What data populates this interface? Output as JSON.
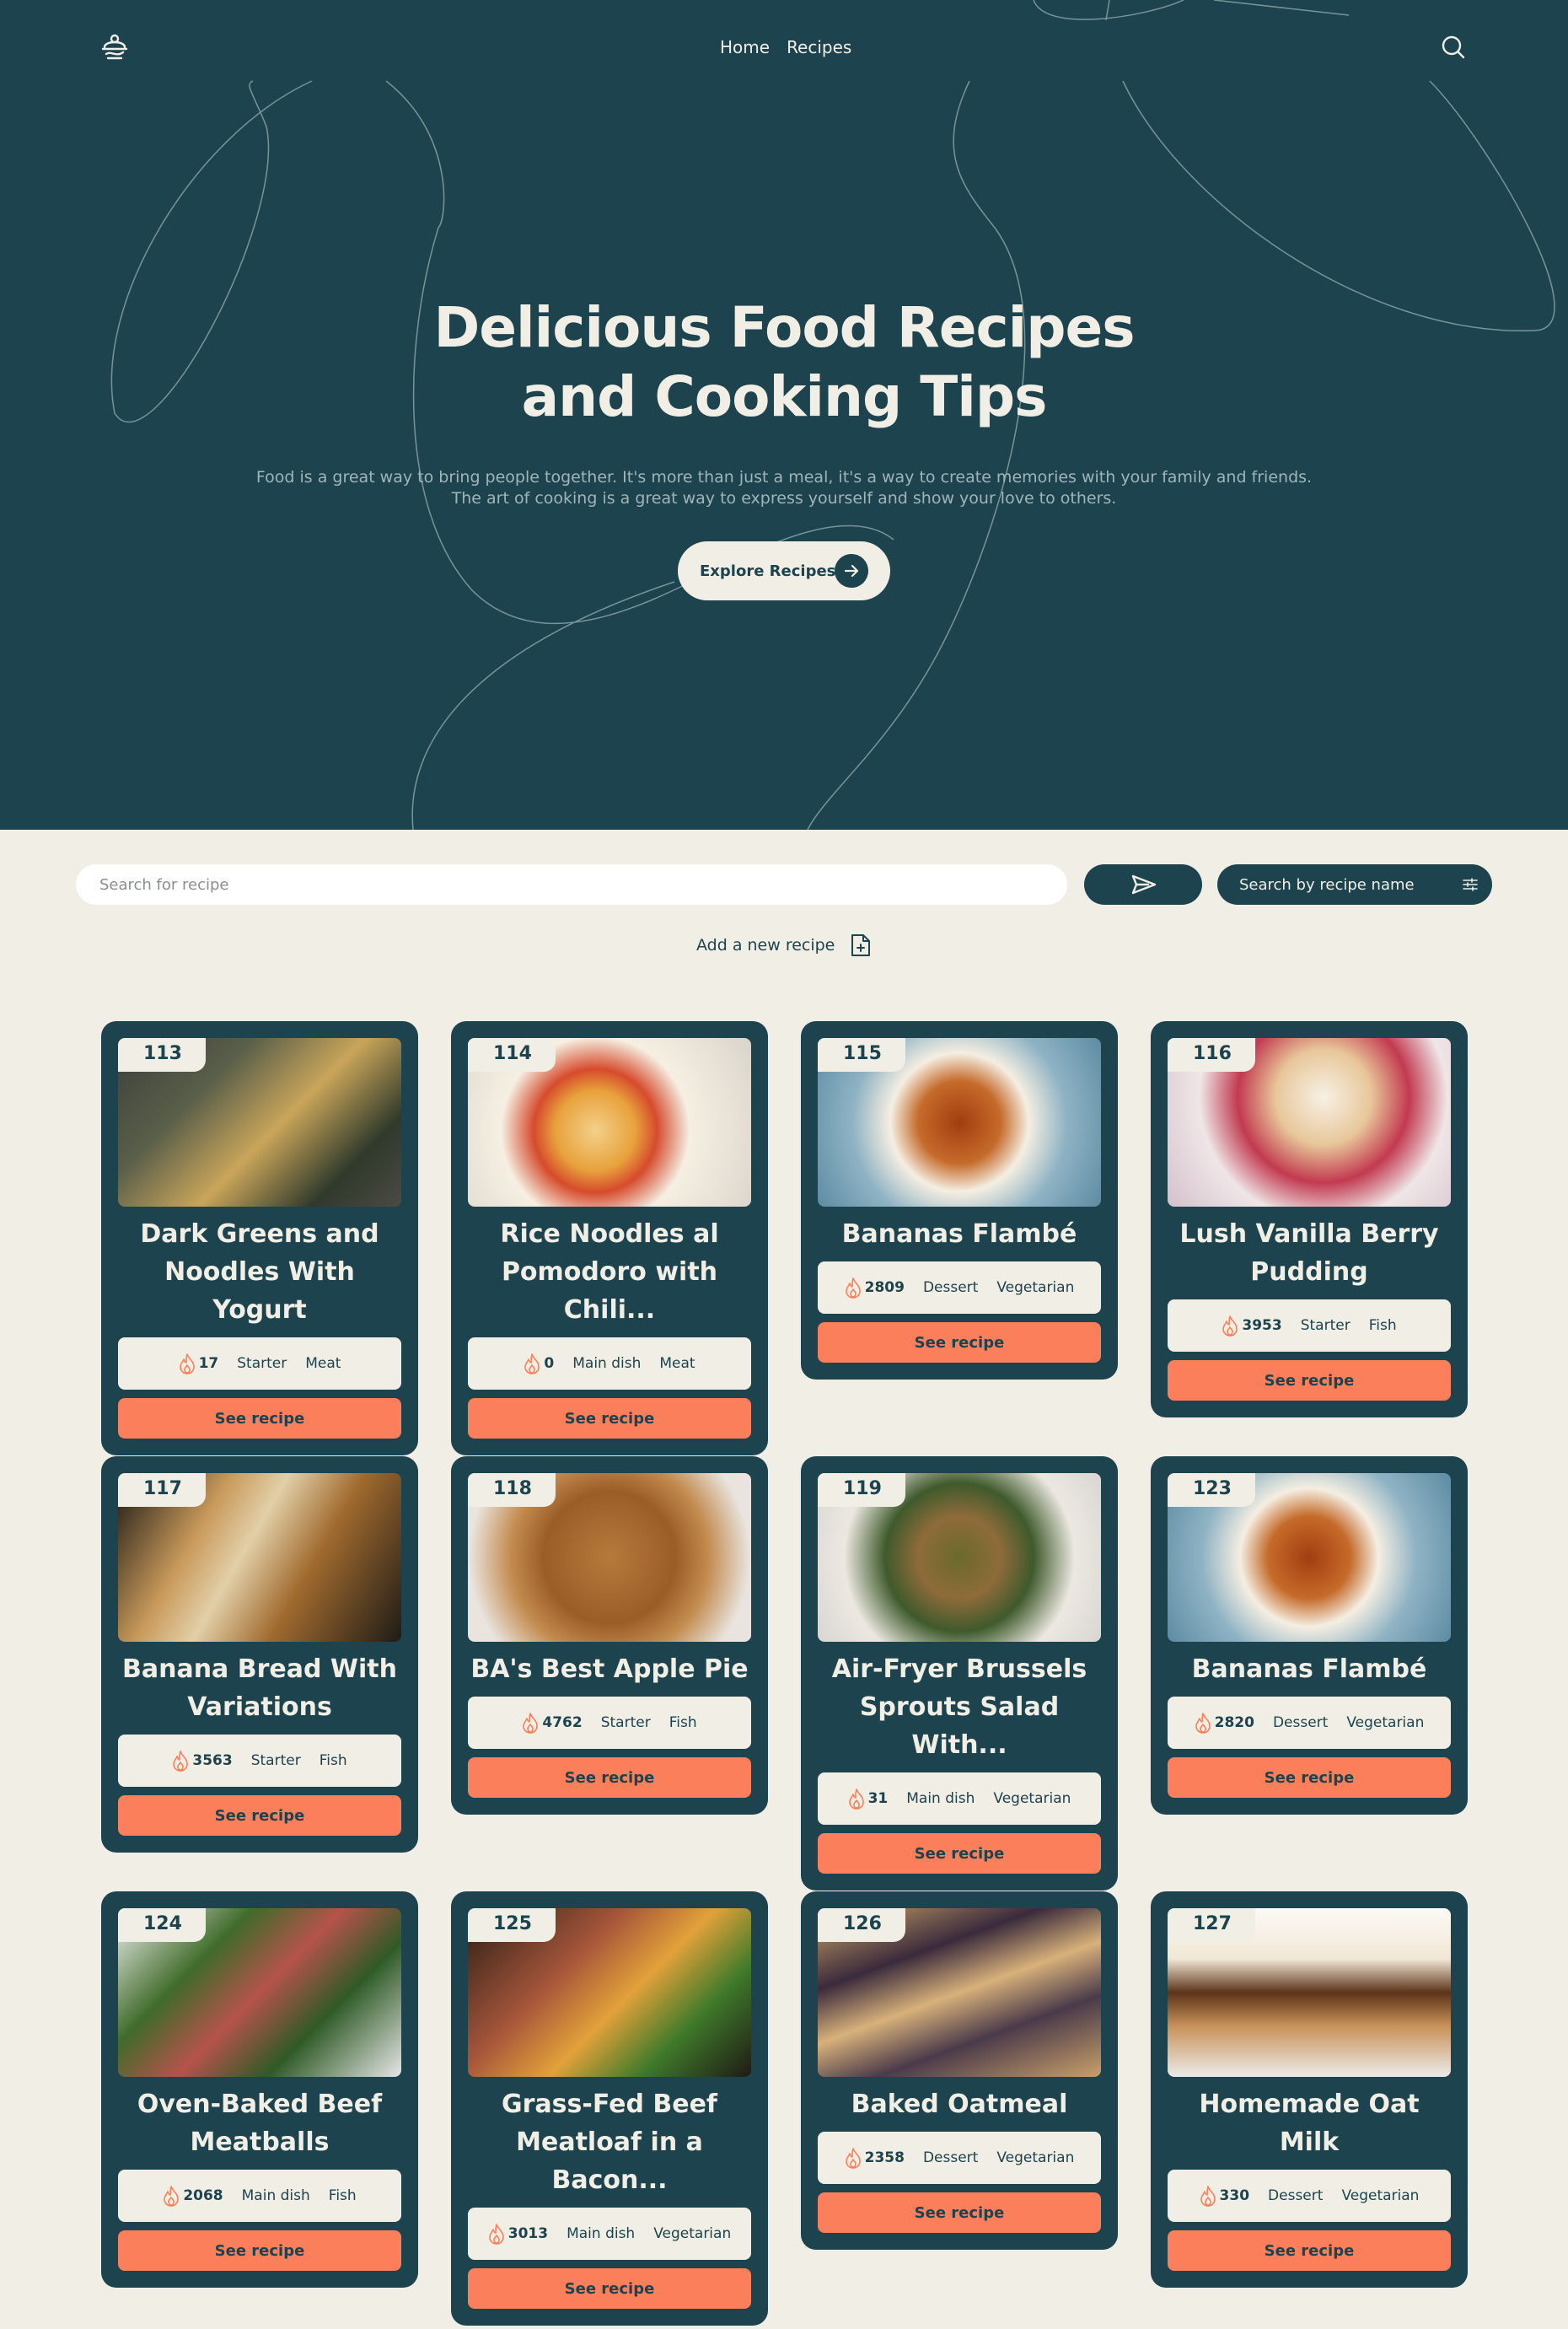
{
  "nav": {
    "home": "Home",
    "recipes": "Recipes"
  },
  "hero": {
    "title_line1": "Delicious Food Recipes",
    "title_line2": "and Cooking Tips",
    "subtitle_line1": "Food is a great way to bring people together. It's more than just a meal, it's a way to create memories with your family and friends.",
    "subtitle_line2": "The art of cooking is a great way to express yourself and show your love to others.",
    "cta": "Explore Recipes"
  },
  "search": {
    "placeholder": "Search for recipe",
    "filter_label": "Search by recipe name",
    "add_recipe": "Add a new recipe"
  },
  "colors": {
    "primary": "#1d434e",
    "background": "#f1efe5",
    "accent": "#fa7f5a"
  },
  "cards": [
    {
      "id": "113",
      "title": "Dark Greens and Noodles With Yogurt",
      "calories": "17",
      "course": "Starter",
      "category": "Meat",
      "button": "See recipe"
    },
    {
      "id": "114",
      "title": "Rice Noodles al Pomodoro with Chili...",
      "calories": "0",
      "course": "Main dish",
      "category": "Meat",
      "button": "See recipe"
    },
    {
      "id": "115",
      "title": "Bananas Flambé",
      "calories": "2809",
      "course": "Dessert",
      "category": "Vegetarian",
      "button": "See recipe"
    },
    {
      "id": "116",
      "title": "Lush Vanilla Berry Pudding",
      "calories": "3953",
      "course": "Starter",
      "category": "Fish",
      "button": "See recipe"
    },
    {
      "id": "117",
      "title": "Banana Bread With Variations",
      "calories": "3563",
      "course": "Starter",
      "category": "Fish",
      "button": "See recipe"
    },
    {
      "id": "118",
      "title": "BA's Best Apple Pie",
      "calories": "4762",
      "course": "Starter",
      "category": "Fish",
      "button": "See recipe"
    },
    {
      "id": "119",
      "title": "Air-Fryer Brussels Sprouts Salad With...",
      "calories": "31",
      "course": "Main dish",
      "category": "Vegetarian",
      "button": "See recipe"
    },
    {
      "id": "123",
      "title": "Bananas Flambé",
      "calories": "2820",
      "course": "Dessert",
      "category": "Vegetarian",
      "button": "See recipe"
    },
    {
      "id": "124",
      "title": "Oven-Baked Beef Meatballs",
      "calories": "2068",
      "course": "Main dish",
      "category": "Fish",
      "button": "See recipe"
    },
    {
      "id": "125",
      "title": "Grass-Fed Beef Meatloaf in a Bacon...",
      "calories": "3013",
      "course": "Main dish",
      "category": "Vegetarian",
      "button": "See recipe"
    },
    {
      "id": "126",
      "title": "Baked Oatmeal",
      "calories": "2358",
      "course": "Dessert",
      "category": "Vegetarian",
      "button": "See recipe"
    },
    {
      "id": "127",
      "title": "Homemade Oat Milk",
      "calories": "330",
      "course": "Dessert",
      "category": "Vegetarian",
      "button": "See recipe"
    }
  ]
}
